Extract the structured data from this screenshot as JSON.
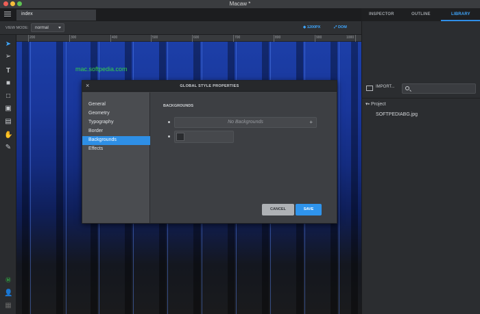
{
  "window": {
    "title": "Macaw *"
  },
  "tabs": {
    "document_tab": "index"
  },
  "right_tabs": [
    {
      "label": "INSPECTOR",
      "active": false
    },
    {
      "label": "OUTLINE",
      "active": false
    },
    {
      "label": "LIBRARY",
      "active": true
    }
  ],
  "toolbar": {
    "view_mode_label": "VIEW MODE:",
    "view_mode_value": "normal",
    "breakpoint_label": "1200PX",
    "dom_label": "DOM"
  },
  "ruler": {
    "labels": [
      "200",
      "300",
      "400",
      "500",
      "600",
      "700",
      "800",
      "900",
      "1000"
    ]
  },
  "canvas": {
    "site_text": "mac.softpedia.com"
  },
  "library": {
    "import_label": "IMPORT...",
    "search_placeholder": "",
    "project_label": "Project",
    "files": [
      "SOFTPEDIABG.jpg"
    ]
  },
  "dialog": {
    "title": "GLOBAL STYLE PROPERTIES",
    "sidebar_items": [
      {
        "label": "General",
        "selected": false
      },
      {
        "label": "Geometry",
        "selected": false
      },
      {
        "label": "Typography",
        "selected": false
      },
      {
        "label": "Border",
        "selected": false
      },
      {
        "label": "Backgrounds",
        "selected": true
      },
      {
        "label": "Effects",
        "selected": false
      }
    ],
    "section_title": "BACKGROUNDS",
    "no_backgrounds_text": "No Backgrounds",
    "cancel_label": "CANCEL",
    "save_label": "SAVE"
  },
  "colors": {
    "accent": "#2f94ec",
    "site_text": "#35d24a",
    "canvas_top": "#1c3fa8"
  },
  "icons": [
    "menu-icon",
    "select-arrow-icon",
    "direct-select-icon",
    "text-tool-icon",
    "rectangle-tool-icon",
    "ellipse-tool-icon",
    "image-tool-icon",
    "pen-tool-icon",
    "hand-tool-icon",
    "eyedropper-icon",
    "search-icon",
    "folder-icon",
    "close-icon",
    "plus-icon"
  ]
}
